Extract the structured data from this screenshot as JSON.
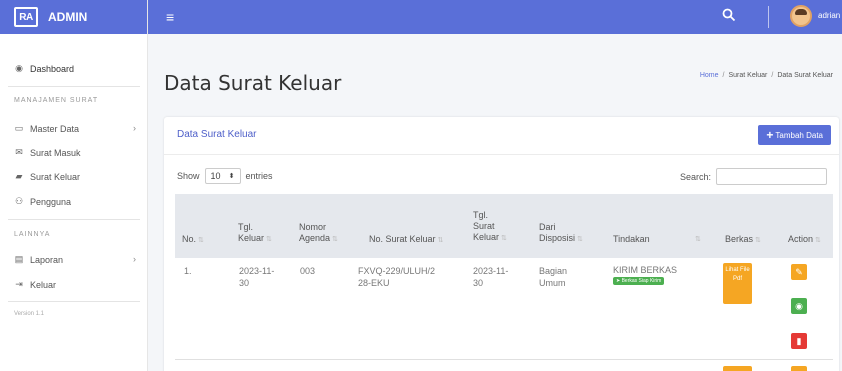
{
  "brand": {
    "logo": "RA",
    "name": "ADMIN"
  },
  "sidebar": {
    "dashboard": "Dashboard",
    "section1": "MANAJAMEN SURAT",
    "items": [
      {
        "label": "Master Data",
        "icon": "calendar-icon",
        "arrow": true
      },
      {
        "label": "Surat Masuk",
        "icon": "mail-icon"
      },
      {
        "label": "Surat Keluar",
        "icon": "car-icon"
      },
      {
        "label": "Pengguna",
        "icon": "users-icon"
      }
    ],
    "section2": "LAINNYA",
    "items2": [
      {
        "label": "Laporan",
        "icon": "file-icon",
        "arrow": true
      },
      {
        "label": "Keluar",
        "icon": "sign-out-icon"
      }
    ],
    "version": "Version 1.1"
  },
  "navbar": {
    "user": "adrian"
  },
  "header": {
    "title": "Data Surat Keluar",
    "breadcrumb": [
      "Home",
      "Surat Keluar",
      "Data Surat Keluar"
    ]
  },
  "card": {
    "title": "Data Surat Keluar",
    "add_label": "Tambah Data",
    "show_prefix": "Show",
    "show_value": "10",
    "show_suffix": "entries",
    "search_label": "Search:"
  },
  "table": {
    "headers": [
      "No.",
      "Tgl. Keluar",
      "Nomor Agenda",
      "No. Surat Keluar",
      "Tgl. Surat Keluar",
      "Dari Disposisi",
      "Tindakan",
      "Berkas",
      "Action"
    ],
    "rows": [
      {
        "no": "1.",
        "tgl_keluar": "2023-11-30",
        "nomor_agenda": "003",
        "no_surat": "FXVQ-229/ULUH/228-EKU",
        "tgl_surat": "2023-11-30",
        "disposisi": "Bagian Umum",
        "tindakan": "KIRIM BERKAS",
        "badge": "Berkas Siap Kirim",
        "berkas": "Lihat File Pdf"
      }
    ]
  },
  "colors": {
    "primary": "#5a6fd8",
    "warning": "#f5a623",
    "success": "#4caf50",
    "danger": "#e53935"
  }
}
